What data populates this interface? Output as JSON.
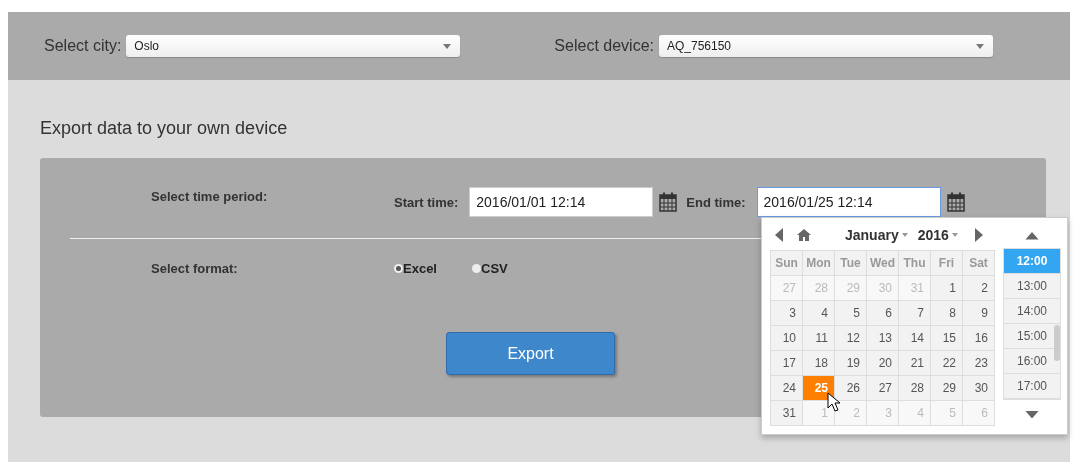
{
  "top_bar": {
    "city": {
      "label": "Select city:",
      "value": "Oslo"
    },
    "device": {
      "label": "Select device:",
      "value": "AQ_756150"
    }
  },
  "heading": "Export data to your own device",
  "period": {
    "label": "Select time period:",
    "start_label": "Start time:",
    "start_value": "2016/01/01 12:14",
    "end_label": "End time:",
    "end_value": "2016/01/25 12:14"
  },
  "format": {
    "label": "Select format:",
    "options": [
      {
        "label": "Excel",
        "selected": true
      },
      {
        "label": "CSV",
        "selected": false
      }
    ]
  },
  "export_button": "Export",
  "picker": {
    "month": "January",
    "year": "2016",
    "weekdays": [
      "Sun",
      "Mon",
      "Tue",
      "Wed",
      "Thu",
      "Fri",
      "Sat"
    ],
    "weeks": [
      [
        {
          "day": "27",
          "muted": true,
          "selected": false
        },
        {
          "day": "28",
          "muted": true,
          "selected": false
        },
        {
          "day": "29",
          "muted": true,
          "selected": false
        },
        {
          "day": "30",
          "muted": true,
          "selected": false
        },
        {
          "day": "31",
          "muted": true,
          "selected": false
        },
        {
          "day": "1",
          "muted": false,
          "selected": false
        },
        {
          "day": "2",
          "muted": false,
          "selected": false
        }
      ],
      [
        {
          "day": "3",
          "muted": false,
          "selected": false
        },
        {
          "day": "4",
          "muted": false,
          "selected": false
        },
        {
          "day": "5",
          "muted": false,
          "selected": false
        },
        {
          "day": "6",
          "muted": false,
          "selected": false
        },
        {
          "day": "7",
          "muted": false,
          "selected": false
        },
        {
          "day": "8",
          "muted": false,
          "selected": false
        },
        {
          "day": "9",
          "muted": false,
          "selected": false
        }
      ],
      [
        {
          "day": "10",
          "muted": false,
          "selected": false
        },
        {
          "day": "11",
          "muted": false,
          "selected": false
        },
        {
          "day": "12",
          "muted": false,
          "selected": false
        },
        {
          "day": "13",
          "muted": false,
          "selected": false
        },
        {
          "day": "14",
          "muted": false,
          "selected": false
        },
        {
          "day": "15",
          "muted": false,
          "selected": false
        },
        {
          "day": "16",
          "muted": false,
          "selected": false
        }
      ],
      [
        {
          "day": "17",
          "muted": false,
          "selected": false
        },
        {
          "day": "18",
          "muted": false,
          "selected": false
        },
        {
          "day": "19",
          "muted": false,
          "selected": false
        },
        {
          "day": "20",
          "muted": false,
          "selected": false
        },
        {
          "day": "21",
          "muted": false,
          "selected": false
        },
        {
          "day": "22",
          "muted": false,
          "selected": false
        },
        {
          "day": "23",
          "muted": false,
          "selected": false
        }
      ],
      [
        {
          "day": "24",
          "muted": false,
          "selected": false
        },
        {
          "day": "25",
          "muted": false,
          "selected": true
        },
        {
          "day": "26",
          "muted": false,
          "selected": false
        },
        {
          "day": "27",
          "muted": false,
          "selected": false
        },
        {
          "day": "28",
          "muted": false,
          "selected": false
        },
        {
          "day": "29",
          "muted": false,
          "selected": false
        },
        {
          "day": "30",
          "muted": false,
          "selected": false
        }
      ],
      [
        {
          "day": "31",
          "muted": false,
          "selected": false
        },
        {
          "day": "1",
          "muted": true,
          "selected": false
        },
        {
          "day": "2",
          "muted": true,
          "selected": false
        },
        {
          "day": "3",
          "muted": true,
          "selected": false
        },
        {
          "day": "4",
          "muted": true,
          "selected": false
        },
        {
          "day": "5",
          "muted": true,
          "selected": false
        },
        {
          "day": "6",
          "muted": true,
          "selected": false
        }
      ]
    ],
    "times": [
      {
        "label": "12:00",
        "selected": true
      },
      {
        "label": "13:00",
        "selected": false
      },
      {
        "label": "14:00",
        "selected": false
      },
      {
        "label": "15:00",
        "selected": false
      },
      {
        "label": "16:00",
        "selected": false
      },
      {
        "label": "17:00",
        "selected": false
      }
    ]
  }
}
